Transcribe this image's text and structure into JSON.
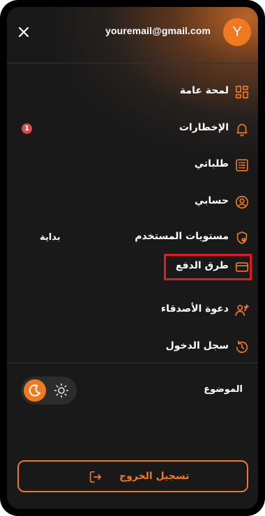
{
  "header": {
    "email": "youremail@gmail.com",
    "avatar_initial": "Y"
  },
  "menu": {
    "items": [
      {
        "label": "لمحة عامة",
        "icon": "dashboard-grid-icon"
      },
      {
        "label": "الإخطارات",
        "icon": "bell-icon",
        "badge": "1"
      },
      {
        "label": "طلباتي",
        "icon": "order-list-icon"
      },
      {
        "label": "حسابي",
        "icon": "user-circle-icon"
      },
      {
        "label": "مستويات المستخدم",
        "icon": "shield-user-icon",
        "value": "بداية"
      },
      {
        "label": "طرق الدفع",
        "icon": "credit-card-icon",
        "highlighted": true
      },
      {
        "label": "دعوة الأصدقاء",
        "icon": "user-plus-icon"
      },
      {
        "label": "سجل الدخول",
        "icon": "history-icon"
      }
    ]
  },
  "theme": {
    "label": "الموضوع",
    "active": "dark"
  },
  "logout": {
    "label": "تسجيل الخروج",
    "icon": "logout-icon"
  },
  "colors": {
    "accent": "#f07a22",
    "background": "#191919",
    "highlight_box": "#e21b23",
    "badge": "#e04848"
  }
}
